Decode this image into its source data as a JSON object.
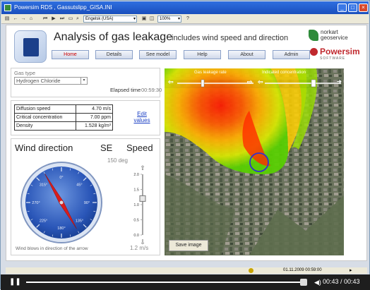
{
  "window": {
    "title": "Powersim RDS , Gassutslipp_GISA.INI",
    "minimize": "_",
    "maximize": "□",
    "close": "×"
  },
  "toolbar": {
    "language": "Engelsk (USA)",
    "zoom": "100%"
  },
  "header": {
    "title": "Analysis of gas leakage",
    "subtitle": "includes wind speed and direction",
    "nav": [
      "Home",
      "Details",
      "See model",
      "Help",
      "About",
      "Admin"
    ],
    "brand_norkart": "norkart geoservice",
    "brand_powersim": "Powersim",
    "brand_powersim_sub": "SOFTWARE"
  },
  "gas": {
    "type_label": "Gas type",
    "type_value": "Hydrogen Chloride",
    "elapsed_label": "Elapsed time",
    "elapsed_value": "00:59:30"
  },
  "properties": {
    "rows": [
      {
        "name": "Diffusion speed",
        "value": "4.70 m/s"
      },
      {
        "name": "Critical concentration",
        "value": "7.00 ppm"
      },
      {
        "name": "Density",
        "value": "1.528 kg/m³"
      }
    ],
    "edit_link_line1": "Edit",
    "edit_link_line2": "values"
  },
  "wind": {
    "title": "Wind direction",
    "direction": "SE",
    "degrees_text": "150 deg",
    "degrees": 150,
    "caption": "Wind blows in direction of the arrow",
    "compass_labels": [
      "0°",
      "45°",
      "90°",
      "135°",
      "180°",
      "225°",
      "270°",
      "315°"
    ],
    "speed_title": "Speed",
    "speed_ticks": [
      "2.0",
      "1.5",
      "1.0",
      "0.5",
      "0.0"
    ],
    "speed_value": "1.2 m/s",
    "speed_level": 1.2
  },
  "map": {
    "label_left": "Gas leakage rate",
    "label_right": "Indicated concentration",
    "save_button": "Save image"
  },
  "status": {
    "timestamp": "01.11.2009 00:59:00"
  },
  "player": {
    "time": "00:43 / 00:43",
    "progress": 1.0
  },
  "colors": {
    "accent": "#1a4fbd",
    "active_nav": "#cc0000",
    "compass_blue": "#2a56b8",
    "needle_red": "#d81d1d"
  }
}
